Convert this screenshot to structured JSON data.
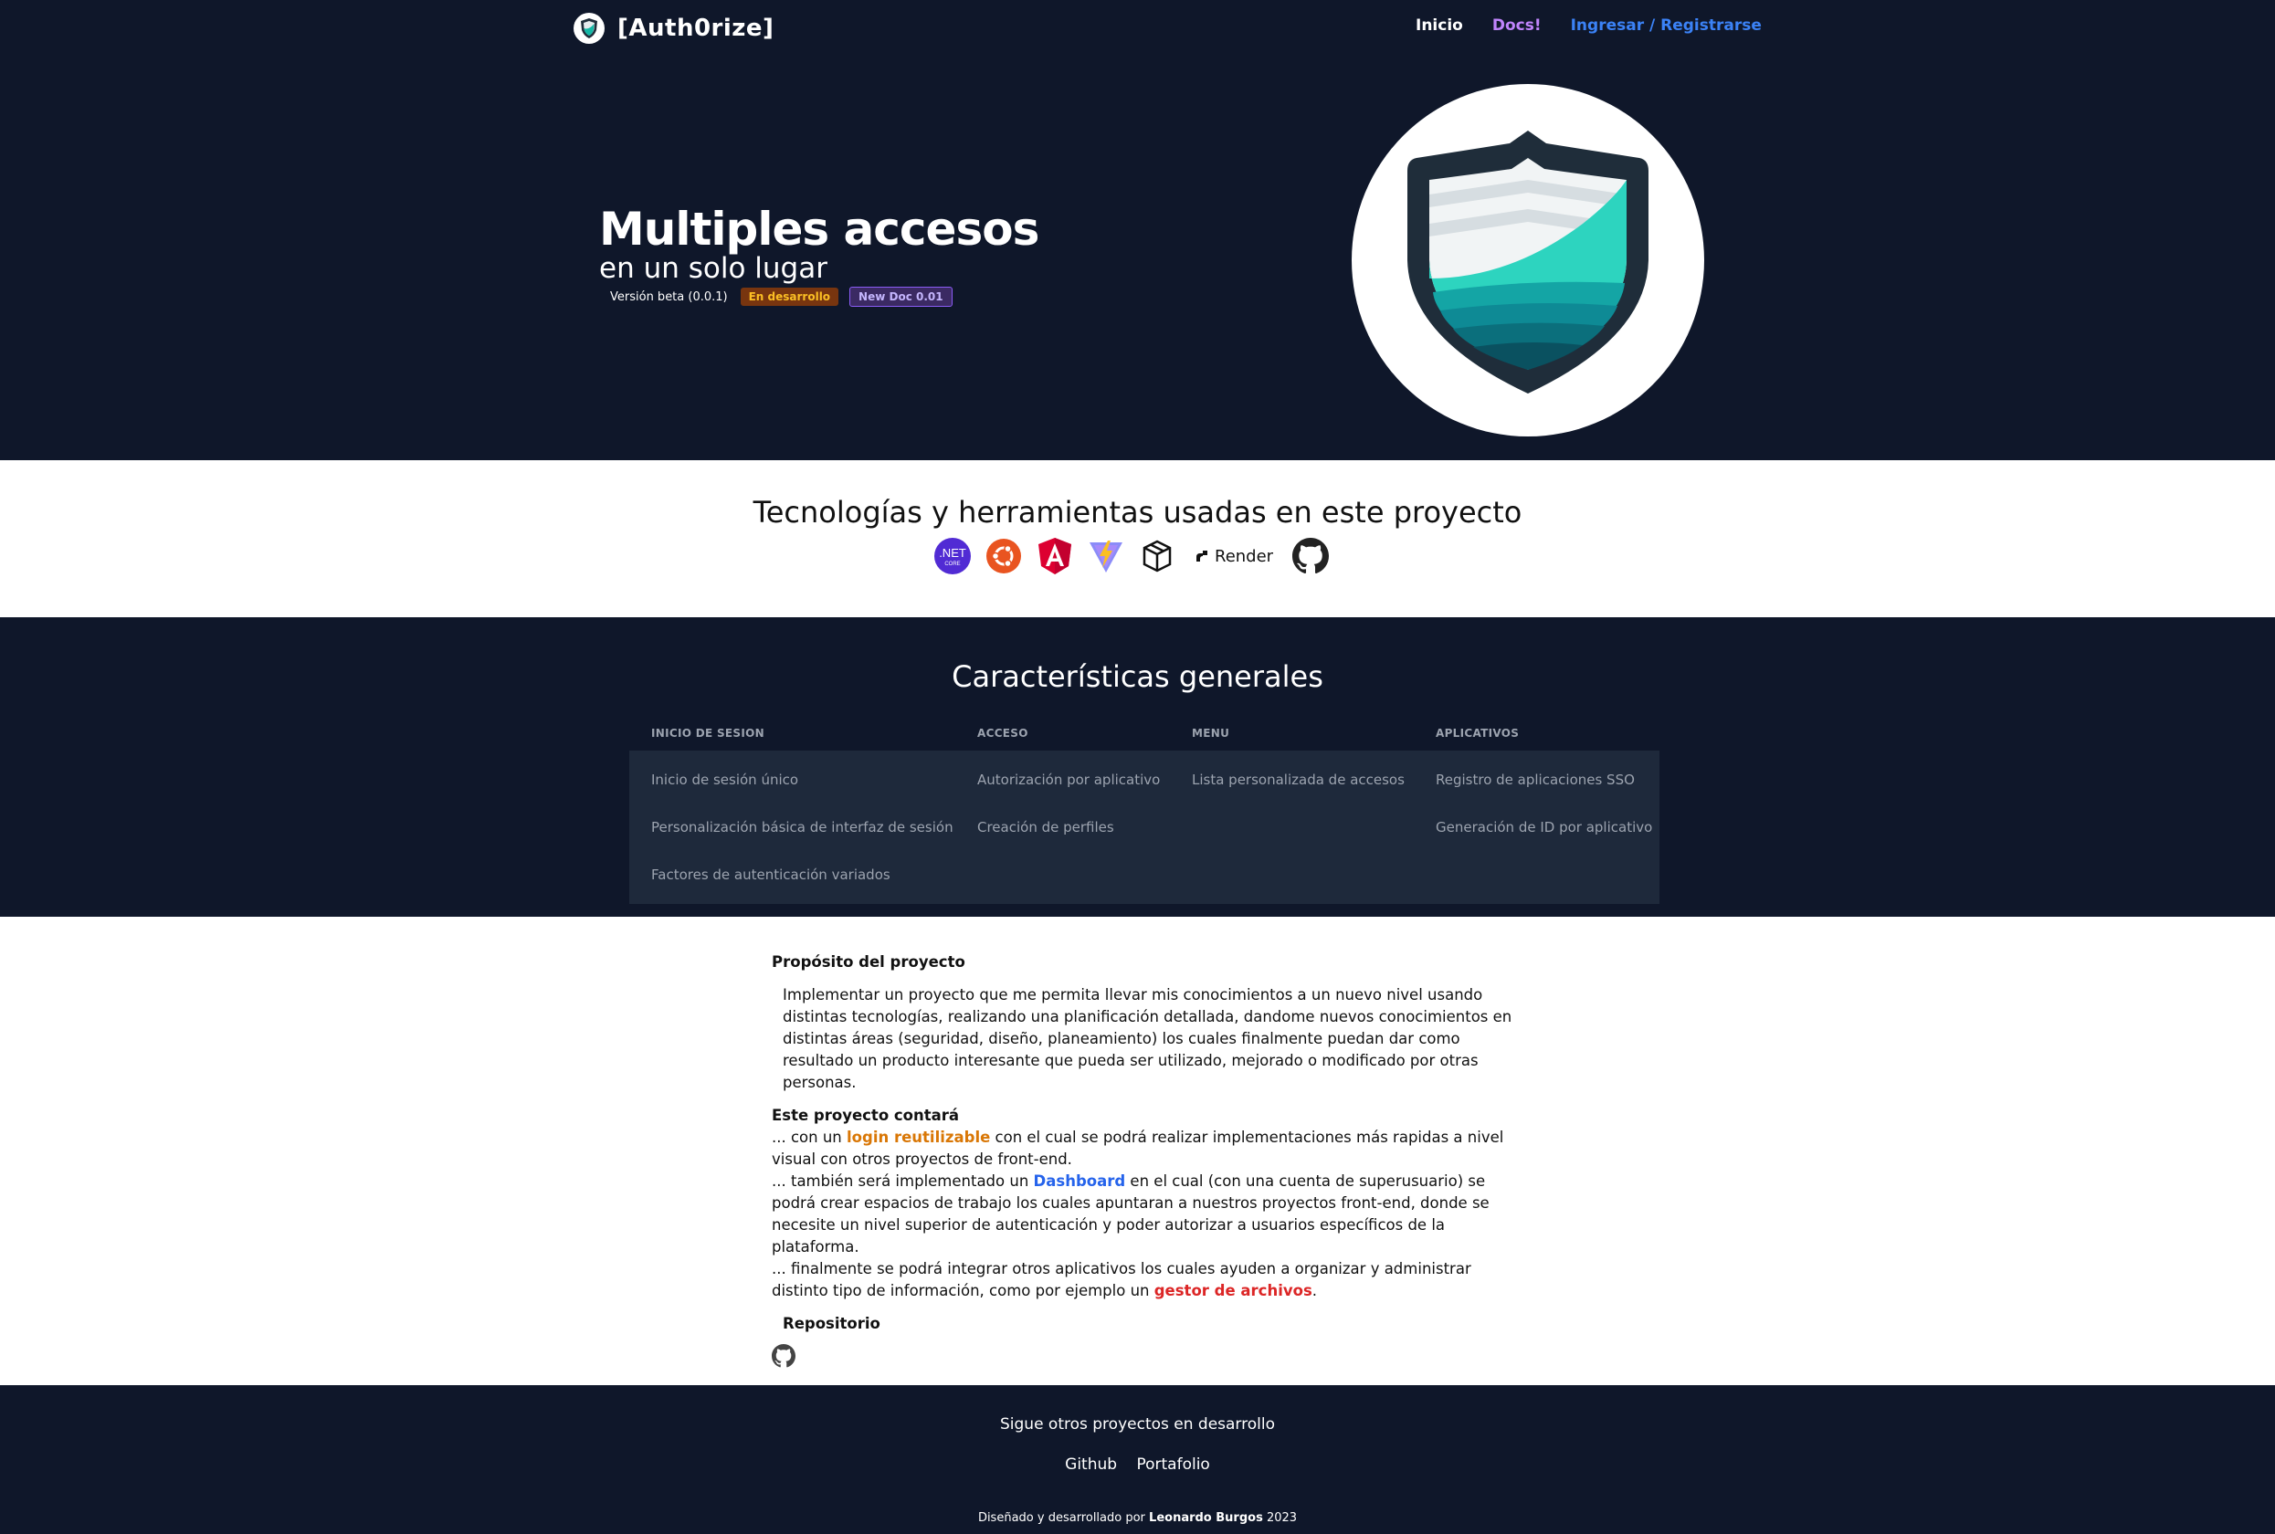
{
  "nav": {
    "brand": "[Auth0rize]",
    "links": {
      "home": "Inicio",
      "docs": "Docs!",
      "login": "Ingresar / Registrarse"
    }
  },
  "hero": {
    "title": "Multiples accesos",
    "subtitle": "en un solo lugar",
    "version": "Versión beta (0.0.1)",
    "badge_dev": "En desarrollo",
    "badge_doc": "New Doc 0.01"
  },
  "tech": {
    "title": "Tecnologías y herramientas usadas en este proyecto",
    "net_label": ".NET",
    "net_sub": "CORE",
    "render_label": "Render",
    "icons": [
      "dotnet-icon",
      "ubuntu-icon",
      "angular-icon",
      "vite-icon",
      "package-icon",
      "render-icon",
      "github-icon"
    ]
  },
  "features": {
    "title": "Características generales",
    "headers": [
      "INICIO DE SESION",
      "ACCESO",
      "MENU",
      "APLICATIVOS"
    ],
    "rows": [
      [
        "Inicio de sesión único",
        "Autorización por aplicativo",
        "Lista personalizada de accesos",
        "Registro de aplicaciones SSO"
      ],
      [
        "Personalización básica de interfaz de sesión",
        "Creación de perfiles",
        "",
        "Generación de ID por aplicativo"
      ],
      [
        "Factores de autenticación variados",
        "",
        "",
        ""
      ]
    ]
  },
  "about": {
    "purpose_title": "Propósito del proyecto",
    "purpose_text": "Implementar un proyecto que me permita llevar mis conocimientos a un nuevo nivel usando distintas tecnologías, realizando una planificación detallada, dandome nuevos conocimientos en distintas áreas (seguridad, diseño, planeamiento) los cuales finalmente puedan dar como resultado un producto interesante que pueda ser utilizado, mejorado o modificado por otras personas.",
    "contara_title": "Este proyecto contará",
    "p1_a": "... con un ",
    "p1_hl": "login reutilizable",
    "p1_b": " con el cual se podrá realizar implementaciones más rapidas a nivel visual con otros proyectos de front-end.",
    "p2_a": "... también será implementado un ",
    "p2_hl": "Dashboard",
    "p2_b": " en el cual (con una cuenta de superusuario) se podrá crear espacios de trabajo los cuales apuntaran a nuestros proyectos front-end, donde se necesite un nivel superior de autenticación y poder autorizar a usuarios específicos de la plataforma.",
    "p3_a": "... finalmente se podrá integrar otros aplicativos los cuales ayuden a organizar y administrar distinto tipo de información, como por ejemplo un ",
    "p3_hl": "gestor de archivos",
    "p3_b": ".",
    "repo_title": "Repositorio"
  },
  "footer": {
    "line1": "Sigue otros proyectos en desarrollo",
    "link_github": "Github",
    "link_portfolio": "Portafolio",
    "credit_a": "Diseñado y desarrollado por ",
    "credit_name": "Leonardo Burgos",
    "credit_b": " 2023"
  },
  "colors": {
    "dark_bg": "#0f172a",
    "table_bg": "#1e293b",
    "accent_blue": "#3b82f6",
    "accent_purple": "#c084fc",
    "shield_teal": "#2dd4bf"
  }
}
